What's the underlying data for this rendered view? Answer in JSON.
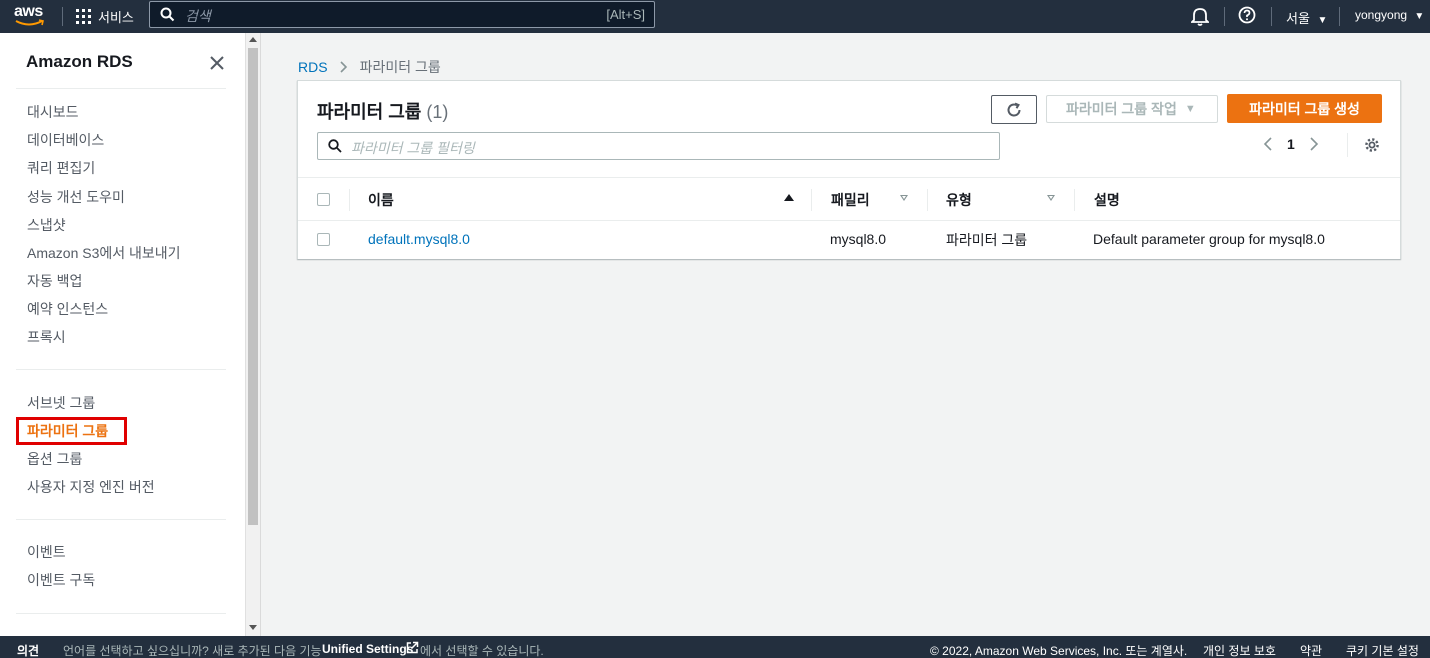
{
  "topnav": {
    "logo": "aws",
    "services_label": "서비스",
    "search_placeholder": "검색",
    "search_shortcut": "[Alt+S]",
    "region": "서울",
    "user": "yongyong",
    "icons": [
      "grid-icon",
      "search-icon",
      "bell-icon",
      "help-icon",
      "caret-down-icon"
    ]
  },
  "sidebar": {
    "title": "Amazon RDS",
    "group1": [
      "대시보드",
      "데이터베이스",
      "쿼리 편집기",
      "성능 개선 도우미",
      "스냅샷",
      "Amazon S3에서 내보내기",
      "자동 백업",
      "예약 인스턴스",
      "프록시"
    ],
    "group2": [
      "서브넷 그룹",
      "파라미터 그룹",
      "옵션 그룹",
      "사용자 지정 엔진 버전"
    ],
    "group3": [
      "이벤트",
      "이벤트 구독"
    ],
    "active_item": "파라미터 그룹"
  },
  "breadcrumb": {
    "root": "RDS",
    "current": "파라미터 그룹"
  },
  "panel": {
    "title": "파라미터 그룹",
    "count": "(1)",
    "actions_label": "파라미터 그룹 작업",
    "create_label": "파라미터 그룹 생성",
    "filter_placeholder": "파라미터 그룹 필터링",
    "page": "1"
  },
  "table": {
    "columns": [
      "이름",
      "패밀리",
      "유형",
      "설명"
    ],
    "rows": [
      {
        "name": "default.mysql8.0",
        "family": "mysql8.0",
        "type": "파라미터 그룹",
        "description": "Default parameter group for mysql8.0"
      }
    ]
  },
  "footer": {
    "feedback": "의견",
    "language_notice": "언어를 선택하고 싶으십니까? 새로 추가된 다음 기능",
    "unified_settings": "Unified Settings",
    "language_notice_end": "에서 선택할 수 있습니다.",
    "copyright": "© 2022, Amazon Web Services, Inc. 또는 계열사.",
    "privacy": "개인 정보 보호",
    "terms": "약관",
    "cookies": "쿠키 기본 설정"
  },
  "colors": {
    "nav_bg": "#232f3e",
    "accent_orange": "#ec7211",
    "link_blue": "#0073bb",
    "highlight_red": "#e00000"
  }
}
